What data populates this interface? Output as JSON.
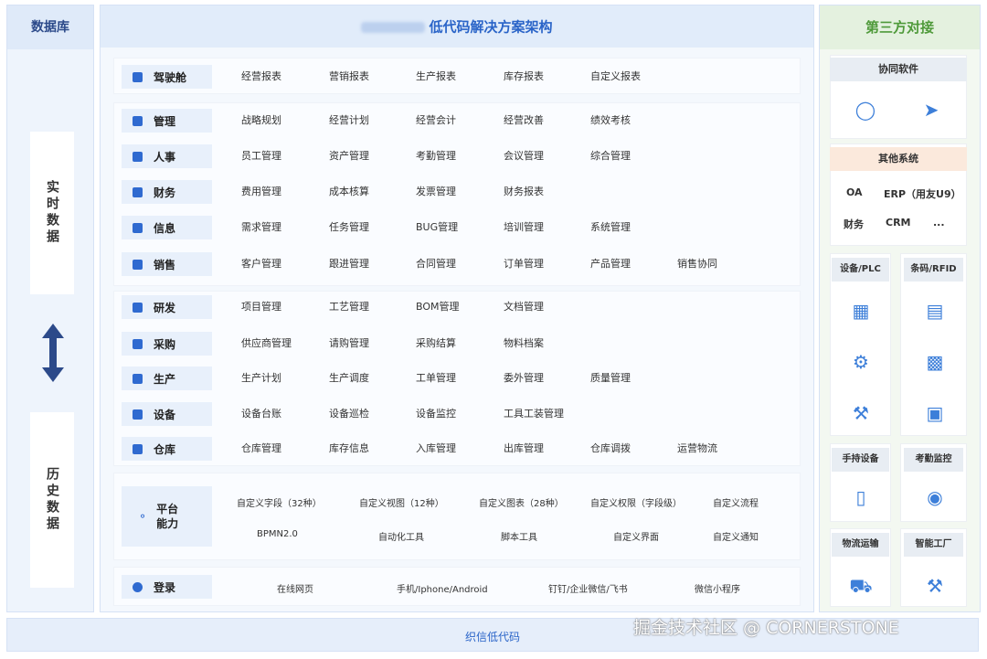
{
  "left": {
    "title": "数据库",
    "realtime": "实时数据",
    "history": "历史数据"
  },
  "center": {
    "title": "低代码解决方案架构",
    "rows": [
      {
        "label": "驾驶舱",
        "items": [
          "经营报表",
          "营销报表",
          "生产报表",
          "库存报表",
          "自定义报表"
        ]
      },
      {
        "label": "管理",
        "items": [
          "战略规划",
          "经营计划",
          "经营会计",
          "经营改善",
          "绩效考核"
        ]
      },
      {
        "label": "人事",
        "items": [
          "员工管理",
          "资产管理",
          "考勤管理",
          "会议管理",
          "综合管理"
        ]
      },
      {
        "label": "财务",
        "items": [
          "费用管理",
          "成本核算",
          "发票管理",
          "财务报表"
        ]
      },
      {
        "label": "信息",
        "items": [
          "需求管理",
          "任务管理",
          "BUG管理",
          "培训管理",
          "系统管理"
        ]
      },
      {
        "label": "销售",
        "items": [
          "客户管理",
          "跟进管理",
          "合同管理",
          "订单管理",
          "产品管理",
          "销售协同"
        ]
      },
      {
        "label": "研发",
        "items": [
          "项目管理",
          "工艺管理",
          "BOM管理",
          "文档管理"
        ]
      },
      {
        "label": "采购",
        "items": [
          "供应商管理",
          "请购管理",
          "采购结算",
          "物料档案"
        ]
      },
      {
        "label": "生产",
        "items": [
          "生产计划",
          "生产调度",
          "工单管理",
          "委外管理",
          "质量管理"
        ]
      },
      {
        "label": "设备",
        "items": [
          "设备台账",
          "设备巡检",
          "设备监控",
          "工具工装管理"
        ]
      },
      {
        "label": "仓库",
        "items": [
          "仓库管理",
          "库存信息",
          "入库管理",
          "出库管理",
          "仓库调拨",
          "运营物流"
        ]
      }
    ],
    "platform": {
      "label_line1": "平台",
      "label_line2": "能力",
      "row1": [
        "自定义字段（32种）",
        "自定义视图（12种）",
        "自定义图表（28种）",
        "自定义权限（字段级）",
        "自定义流程"
      ],
      "row2": [
        "BPMN2.0",
        "自动化工具",
        "脚本工具",
        "自定义界面",
        "自定义通知"
      ]
    },
    "login": {
      "label": "登录",
      "items": [
        "在线网页",
        "手机/Iphone/Android",
        "钉钉/企业微信/飞书",
        "微信小程序"
      ]
    }
  },
  "right": {
    "title": "第三方对接",
    "collab": "协同软件",
    "other": "其他系统",
    "other_items": [
      "OA",
      "ERP（用友U9）",
      "财务",
      "CRM",
      "..."
    ],
    "device_plc": "设备/PLC",
    "barcode": "条码/RFID",
    "handheld": "手持设备",
    "attendance": "考勤监控",
    "logistics": "物流运输",
    "factory": "智能工厂"
  },
  "bottom": {
    "label": "织信低代码",
    "watermark": "掘金技术社区 @ CORNERSTONE"
  },
  "colors": {
    "accent": "#2a64c8",
    "green": "#4f9a3a",
    "arrow": "#2c4a8a"
  }
}
